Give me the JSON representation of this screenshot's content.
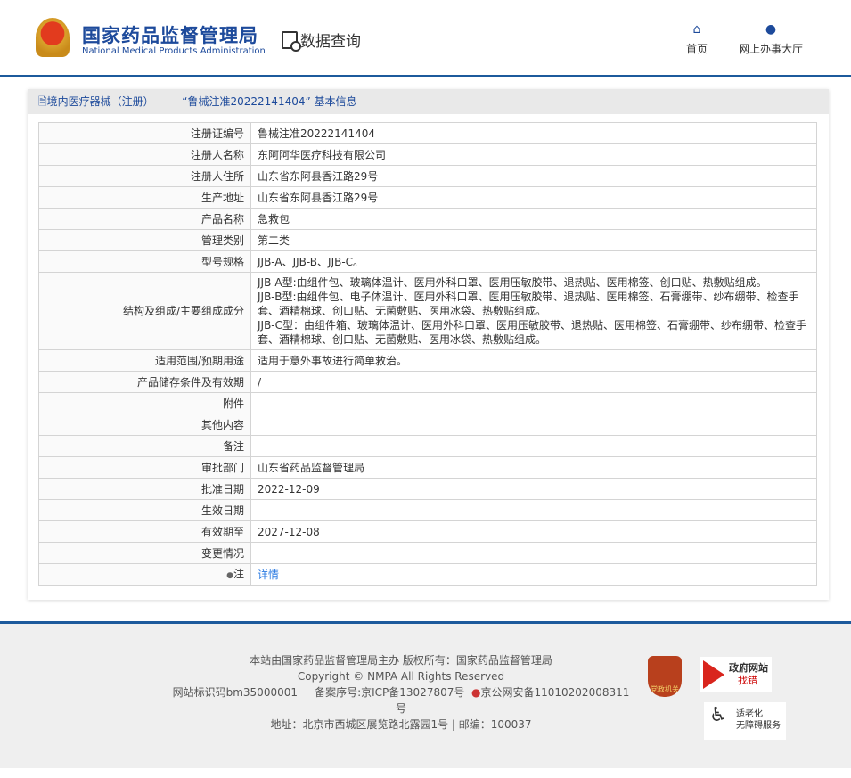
{
  "header": {
    "logo_cn": "国家药品监督管理局",
    "logo_en": "National Medical Products Administration",
    "section": "数据查询",
    "nav": [
      {
        "label": "首页",
        "icon": "home-icon"
      },
      {
        "label": "网上办事大厅",
        "icon": "user-icon"
      }
    ]
  },
  "panel": {
    "title": "境内医疗器械（注册） —— “鲁械注准20222141404” 基本信息"
  },
  "rows": [
    {
      "label": "注册证编号",
      "value": "鲁械注准20222141404"
    },
    {
      "label": "注册人名称",
      "value": "东阿阿华医疗科技有限公司"
    },
    {
      "label": "注册人住所",
      "value": "山东省东阿县香江路29号"
    },
    {
      "label": "生产地址",
      "value": "山东省东阿县香江路29号"
    },
    {
      "label": "产品名称",
      "value": "急救包"
    },
    {
      "label": "管理类别",
      "value": "第二类"
    },
    {
      "label": "型号规格",
      "value": "JJB-A、JJB-B、JJB-C。"
    },
    {
      "label": "结构及组成/主要组成成分",
      "lines": [
        "JJB-A型:由组件包、玻璃体温计、医用外科口罩、医用压敏胶带、退热贴、医用棉签、创口贴、热敷贴组成。",
        "JJB-B型:由组件包、电子体温计、医用外科口罩、医用压敏胶带、退热贴、医用棉签、石膏绷带、纱布绷带、检查手套、酒精棉球、创口贴、无菌敷贴、医用冰袋、热敷贴组成。",
        "JJB-C型：由组件箱、玻璃体温计、医用外科口罩、医用压敏胶带、退热贴、医用棉签、石膏绷带、纱布绷带、检查手套、酒精棉球、创口贴、无菌敷贴、医用冰袋、热敷贴组成。"
      ]
    },
    {
      "label": "适用范围/预期用途",
      "value": "适用于意外事故进行简单救治。"
    },
    {
      "label": "产品储存条件及有效期",
      "value": "/"
    },
    {
      "label": "附件",
      "value": ""
    },
    {
      "label": "其他内容",
      "value": ""
    },
    {
      "label": "备注",
      "value": ""
    },
    {
      "label": "审批部门",
      "value": "山东省药品监督管理局"
    },
    {
      "label": "批准日期",
      "value": "2022-12-09"
    },
    {
      "label": "生效日期",
      "value": ""
    },
    {
      "label": "有效期至",
      "value": "2027-12-08"
    },
    {
      "label": "变更情况",
      "value": ""
    },
    {
      "label": "注",
      "value": "详情"
    }
  ],
  "footer": {
    "line1": "本站由国家药品监督管理局主办 版权所有：国家药品监督管理局",
    "line2": "Copyright © NMPA All Rights Reserved",
    "line3a": "网站标识码bm35000001",
    "line3b": "备案序号:京ICP备13027807号",
    "line3c": "京公网安备11010202008311号",
    "line4": "地址：北京市西城区展览路北露园1号 | 邮编：100037",
    "badge1": "党政机关",
    "badge2a": "政府网站",
    "badge2b": "找错",
    "badge3a": "适老化",
    "badge3b": "无障碍服务"
  },
  "colors": {
    "brand": "#1d4a9b",
    "link": "#2a7ae2",
    "rule": "#1c5a9c"
  }
}
